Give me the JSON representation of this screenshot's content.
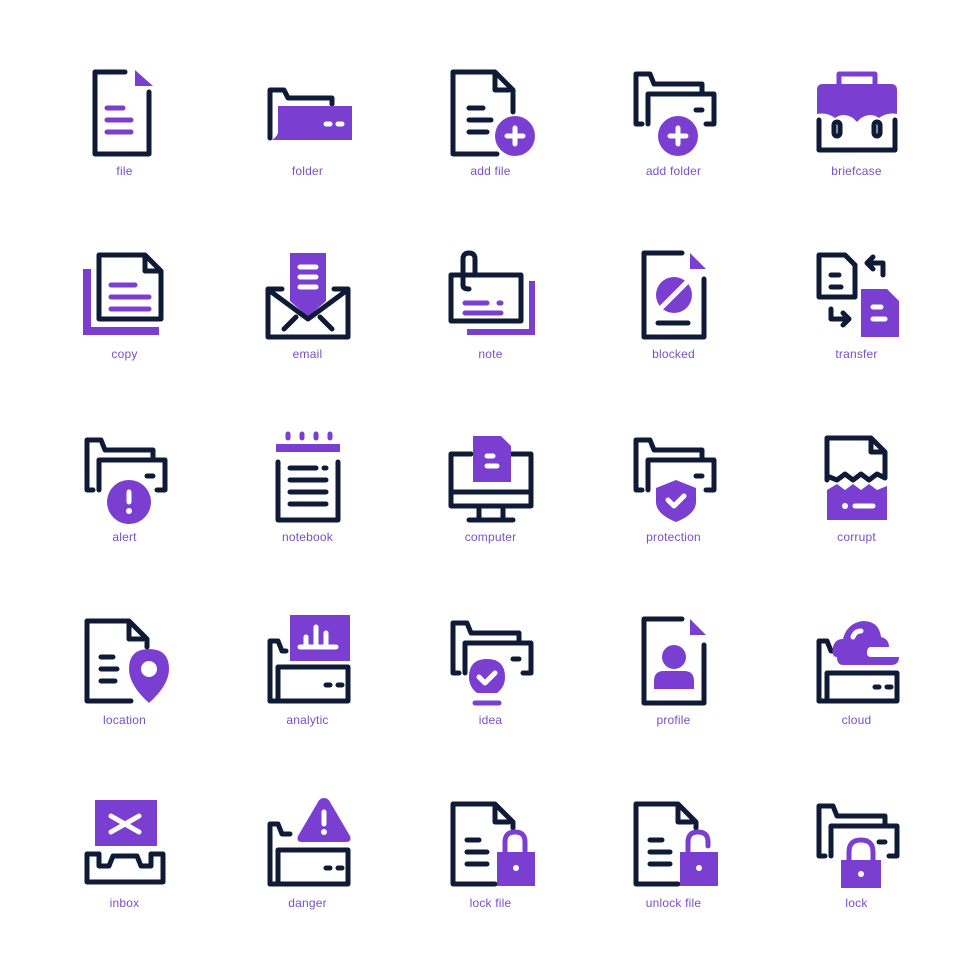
{
  "colors": {
    "dark": "#0f1b36",
    "accent": "#7a3fd1",
    "label": "#7b4fc4",
    "background": "#ffffff"
  },
  "icons": [
    {
      "name": "file",
      "label": "file"
    },
    {
      "name": "folder",
      "label": "folder"
    },
    {
      "name": "add-file",
      "label": "add file"
    },
    {
      "name": "add-folder",
      "label": "add folder"
    },
    {
      "name": "briefcase",
      "label": "briefcase"
    },
    {
      "name": "copy",
      "label": "copy"
    },
    {
      "name": "email",
      "label": "email"
    },
    {
      "name": "note",
      "label": "note"
    },
    {
      "name": "blocked",
      "label": "blocked"
    },
    {
      "name": "transfer",
      "label": "transfer"
    },
    {
      "name": "alert",
      "label": "alert"
    },
    {
      "name": "notebook",
      "label": "notebook"
    },
    {
      "name": "computer",
      "label": "computer"
    },
    {
      "name": "protection",
      "label": "protection"
    },
    {
      "name": "corrupt",
      "label": "corrupt"
    },
    {
      "name": "location",
      "label": "location"
    },
    {
      "name": "analytic",
      "label": "analytic"
    },
    {
      "name": "idea",
      "label": "idea"
    },
    {
      "name": "profile",
      "label": "profile"
    },
    {
      "name": "cloud",
      "label": "cloud"
    },
    {
      "name": "inbox",
      "label": "inbox"
    },
    {
      "name": "danger",
      "label": "danger"
    },
    {
      "name": "lock-file",
      "label": "lock file"
    },
    {
      "name": "unlock-file",
      "label": "unlock file"
    },
    {
      "name": "lock",
      "label": "lock"
    }
  ]
}
